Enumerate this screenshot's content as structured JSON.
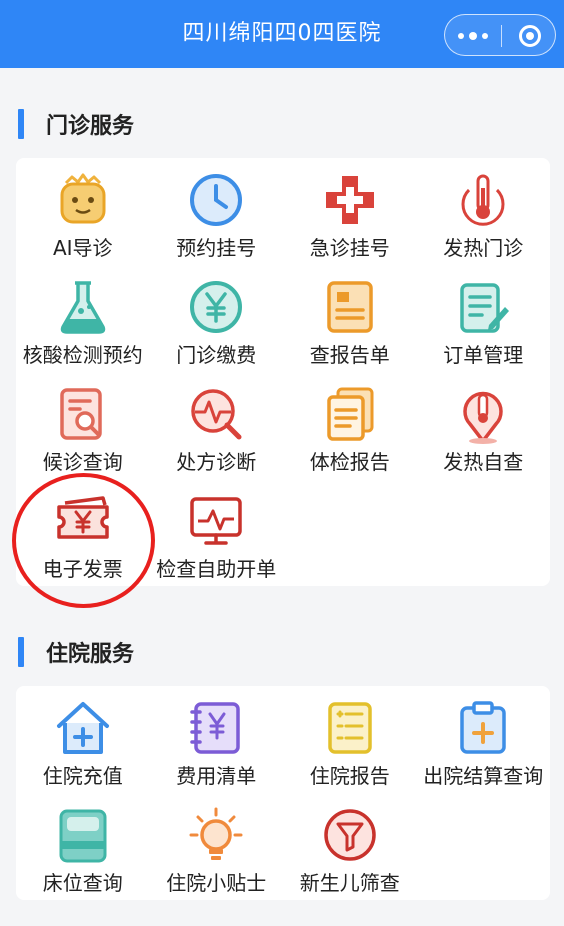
{
  "header": {
    "title": "四川绵阳四0四医院"
  },
  "outpatient": {
    "heading": "门诊服务",
    "items": [
      {
        "label": "AI导诊",
        "icon": "robot-icon"
      },
      {
        "label": "预约挂号",
        "icon": "clock-icon"
      },
      {
        "label": "急诊挂号",
        "icon": "emergency-cross-icon"
      },
      {
        "label": "发热门诊",
        "icon": "thermometer-icon"
      },
      {
        "label": "核酸检测预约",
        "icon": "flask-icon"
      },
      {
        "label": "门诊缴费",
        "icon": "yuan-coin-icon"
      },
      {
        "label": "查报告单",
        "icon": "report-icon"
      },
      {
        "label": "订单管理",
        "icon": "order-edit-icon"
      },
      {
        "label": "候诊查询",
        "icon": "search-document-icon"
      },
      {
        "label": "处方诊断",
        "icon": "diagnosis-icon"
      },
      {
        "label": "体检报告",
        "icon": "checkup-documents-icon"
      },
      {
        "label": "发热自查",
        "icon": "fever-location-icon"
      },
      {
        "label": "电子发票",
        "icon": "invoice-ticket-icon"
      },
      {
        "label": "检查自助开单",
        "icon": "monitor-pulse-icon"
      }
    ]
  },
  "inpatient": {
    "heading": "住院服务",
    "items": [
      {
        "label": "住院充值",
        "icon": "house-plus-icon"
      },
      {
        "label": "费用清单",
        "icon": "fee-list-icon"
      },
      {
        "label": "住院报告",
        "icon": "report-list-icon"
      },
      {
        "label": "出院结算查询",
        "icon": "clipboard-plus-icon"
      },
      {
        "label": "床位查询",
        "icon": "bed-icon"
      },
      {
        "label": "住院小贴士",
        "icon": "lightbulb-icon"
      },
      {
        "label": "新生儿筛查",
        "icon": "funnel-icon"
      }
    ]
  },
  "colors": {
    "header": "#2f86f6",
    "accent_red": "#c8322c",
    "icon_yellow": "#f0b23c",
    "icon_blue": "#3d8ee6",
    "icon_teal": "#3fb5a6",
    "icon_purple": "#7c5cd6",
    "highlight": "#e8201e"
  }
}
